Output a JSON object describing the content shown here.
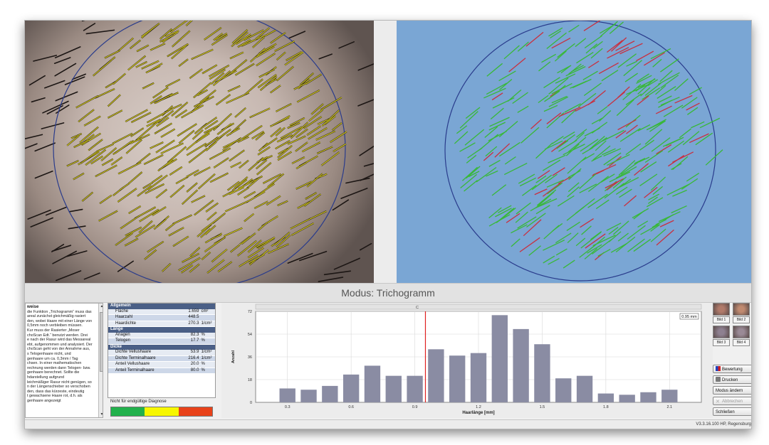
{
  "mode_title": "Modus: Trichogramm",
  "hints": {
    "title": "weise",
    "body": "die Funktion „Trichogramm“ muss das\nareal zunächst gleichmäßig rasiert\nden, wobei Haare mit einer Länge von\n0,5mm noch verbleiben müssen.\nKur muss der Rasierter „Moser\nchoScan Edt.“ benutzt werden. Drei\ne nach der Rasur wird das Messareal\nebt, aufgenommen und analysiert. Der\nchoScan geht von der Annahme aus,\ns Telogenhaare nicht, und\ngenhaare um ca. 0,3mm / Tag\nchsen. In einer mathematischen\nrechnung werden dann Telogen- bzw.\ngenhaare berechnet. Sollte die\nhdarstellung aufgrund\nleichmäßiger Rasur nicht genügen, so\nn der Längenschieber so verschoben\nden, dass das kürzeste, eindeutig\nt gewachsene Haare rot, d.h. als\ngenhaare angezeigt"
  },
  "stats": [
    {
      "section": "Allgemein",
      "rows": [
        {
          "label": "Fläche",
          "value": "1.659",
          "unit": "cm²"
        },
        {
          "label": "Haarzahl",
          "value": "448.5",
          "unit": ""
        },
        {
          "label": "Haardichte",
          "value": "270.3",
          "unit": "1/cm²"
        }
      ]
    },
    {
      "section": "Länge",
      "rows": [
        {
          "label": "Anagen",
          "value": "82.3",
          "unit": "%"
        },
        {
          "label": "Telogen",
          "value": "17.7",
          "unit": "%"
        }
      ]
    },
    {
      "section": "Dicke",
      "rows": [
        {
          "label": "Dichte Vellushaare",
          "value": "53.9",
          "unit": "1/cm²"
        },
        {
          "label": "Dichte Terminalhaare",
          "value": "216.4",
          "unit": "1/cm²"
        },
        {
          "label": "Anteil Vellushaare",
          "value": "20.0",
          "unit": "%"
        },
        {
          "label": "Anteil Terminalhaare",
          "value": "80.0",
          "unit": "%"
        }
      ]
    }
  ],
  "diagnosis": {
    "label": "Nicht für endgültige Diagnose",
    "colors": [
      "#22b14c",
      "#f7f700",
      "#e8421a"
    ]
  },
  "chart_data": {
    "type": "bar",
    "x": [
      0.2,
      0.3,
      0.4,
      0.5,
      0.6,
      0.7,
      0.8,
      0.9,
      1.0,
      1.1,
      1.2,
      1.3,
      1.4,
      1.5,
      1.6,
      1.7,
      1.8,
      1.9,
      2.0,
      2.1
    ],
    "values": [
      11,
      10,
      13,
      22,
      29,
      21,
      21,
      42,
      37,
      39,
      69,
      58,
      46,
      19,
      21,
      7,
      6,
      8,
      10
    ],
    "x_ticks": [
      "0.3",
      "0.6",
      "0.9",
      "1.2",
      "1.5",
      "1.8",
      "2.1"
    ],
    "y_ticks": [
      "0",
      "18",
      "36",
      "54",
      "72"
    ],
    "ylim": [
      0,
      72
    ],
    "xlabel": "Haarlänge [mm]",
    "ylabel": "Anzahl",
    "marker_x": 0.95,
    "marker_label": "0.95 mm",
    "slider_label": "C",
    "bar_color": "#8a8ca3",
    "marker_color": "#e02020",
    "grid": true
  },
  "thumbnails": [
    {
      "label": "Bild 1",
      "tone": "#b07a6a"
    },
    {
      "label": "Bild 2",
      "tone": "#c08a70"
    },
    {
      "label": "Bild 3",
      "tone": "#8e8090"
    },
    {
      "label": "Bild 4",
      "tone": "#9a8a96"
    }
  ],
  "buttons": {
    "evaluate": "Bewertung",
    "print": "Drucken",
    "change_mode": "Modus ändern",
    "delete": "Abbrechen",
    "close": "Schließen"
  },
  "status": {
    "version": "V3.3.16.100   HP, Regensburg"
  },
  "colors": {
    "accepted_hair": "#e8e020",
    "anagen": "#38b838",
    "telogen": "#c83040",
    "circle": "#2a3c8c"
  }
}
